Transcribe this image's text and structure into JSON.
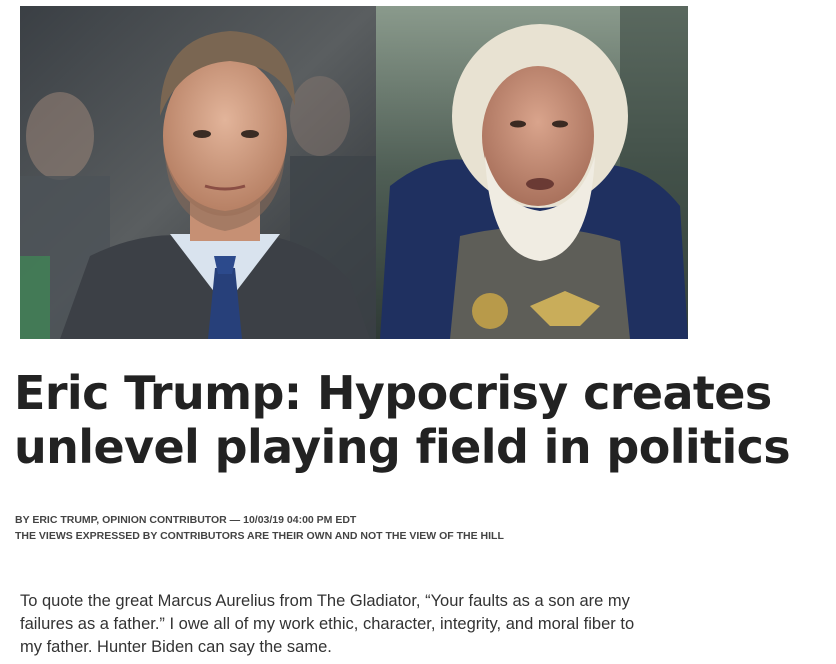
{
  "article": {
    "headline_line1": "Eric Trump: Hypocrisy creates",
    "headline_line2": "unlevel playing field in politics",
    "byline": "BY ERIC TRUMP, OPINION CONTRIBUTOR — 10/03/19 04:00 PM EDT",
    "disclaimer": "THE VIEWS EXPRESSED BY CONTRIBUTORS ARE THEIR OWN AND NOT THE VIEW OF THE HILL",
    "body_text": "To quote the great Marcus Aurelius from The Gladiator, “Your faults as a son are my failures as a father.” I owe all of my work ethic, character, integrity, and moral fiber to my father. Hunter Biden can say the same."
  },
  "hero_image": {
    "left_panel": "portrait of man in suit with blue tie",
    "right_panel": "white-haired bearded man in armor"
  }
}
